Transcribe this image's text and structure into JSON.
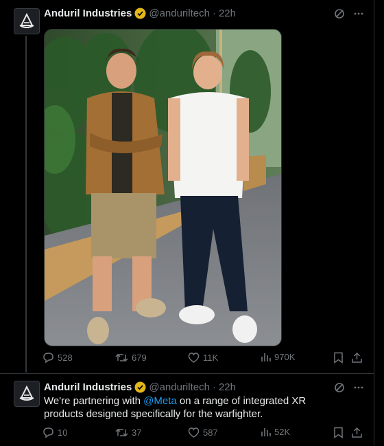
{
  "tweets": [
    {
      "author": "Anduril Industries",
      "handle": "@anduriltech",
      "time": "22h",
      "text_before": "",
      "mention": "",
      "text_after": "",
      "stats": {
        "replies": "528",
        "retweets": "679",
        "likes": "11K",
        "views": "970K"
      }
    },
    {
      "author": "Anduril Industries",
      "handle": "@anduriltech",
      "time": "22h",
      "text_before": "We're partnering with ",
      "mention": "@Meta",
      "text_after": " on a range of integrated XR products designed specifically for the warfighter.",
      "stats": {
        "replies": "10",
        "retweets": "37",
        "likes": "587",
        "views": "52K"
      }
    }
  ],
  "colors": {
    "background": "#000000",
    "accent": "#1d9bf0",
    "muted": "#71767b",
    "verified": "#e2b719"
  },
  "icons": [
    "anduril-logo-icon",
    "verified-badge-icon",
    "grok-icon",
    "more-icon",
    "reply-icon",
    "retweet-icon",
    "like-icon",
    "views-icon",
    "bookmark-icon",
    "share-icon"
  ]
}
